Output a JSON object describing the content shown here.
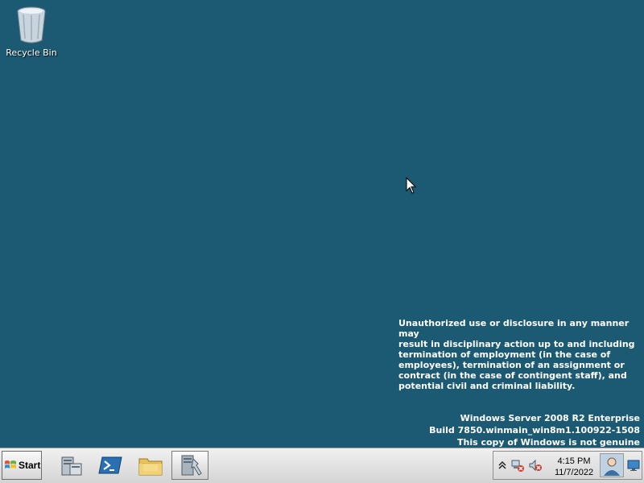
{
  "desktop": {
    "background": "#1c5a74",
    "icons": [
      {
        "label": "Recycle Bin",
        "icon": "recycle-bin-icon"
      }
    ],
    "legal_notice": "Unauthorized use or disclosure in any manner may\nresult in disciplinary action up to and including\ntermination of employment (in the case of\nemployees), termination of an assignment or\ncontract (in the case of contingent staff), and\npotential civil and criminal liability.",
    "watermark": {
      "line1": "Windows Server 2008 R2 Enterprise",
      "line2": "Build 7850.winmain_win8m1.100922-1508",
      "line3": "This copy of Windows is not genuine"
    }
  },
  "taskbar": {
    "start_label": "Start",
    "pinned": [
      {
        "name": "server-manager",
        "icon": "server-manager-icon"
      },
      {
        "name": "powershell",
        "icon": "powershell-icon"
      },
      {
        "name": "windows-explorer",
        "icon": "folder-icon"
      },
      {
        "name": "admin-tools",
        "icon": "admin-tools-icon",
        "active": true
      }
    ],
    "tray": {
      "icons": [
        "chevron-up-icon",
        "network-error-icon",
        "speaker-muted-icon"
      ],
      "time": "4:15 PM",
      "date": "11/7/2022"
    }
  }
}
